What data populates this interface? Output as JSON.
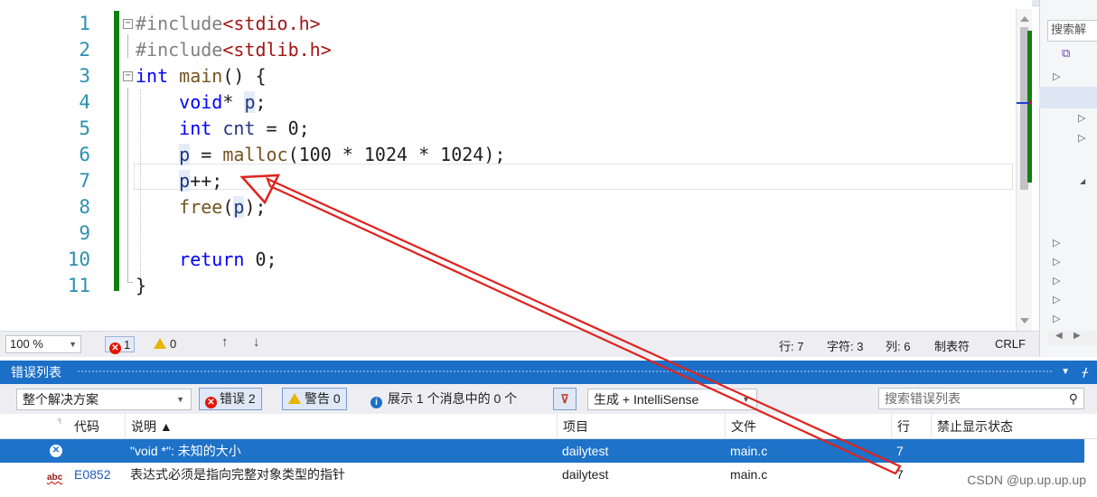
{
  "editor": {
    "line_numbers": [
      "1",
      "2",
      "3",
      "4",
      "5",
      "6",
      "7",
      "8",
      "9",
      "10",
      "11"
    ],
    "lines": [
      [
        {
          "t": "#include",
          "c": "pp"
        },
        {
          "t": "<stdio.h>",
          "c": "str"
        }
      ],
      [
        {
          "t": "#include",
          "c": "pp"
        },
        {
          "t": "<stdlib.h>",
          "c": "str"
        }
      ],
      [
        {
          "t": "int",
          "c": "kw"
        },
        {
          "t": " "
        },
        {
          "t": "main",
          "c": "fn"
        },
        {
          "t": "() {"
        }
      ],
      [
        {
          "t": "    "
        },
        {
          "t": "void",
          "c": "kw"
        },
        {
          "t": "* "
        },
        {
          "t": "p",
          "c": "var hl-var"
        },
        {
          "t": ";"
        }
      ],
      [
        {
          "t": "    "
        },
        {
          "t": "int",
          "c": "kw"
        },
        {
          "t": " "
        },
        {
          "t": "cnt",
          "c": "var"
        },
        {
          "t": " = 0;"
        }
      ],
      [
        {
          "t": "    "
        },
        {
          "t": "p",
          "c": "var hl-var"
        },
        {
          "t": " = "
        },
        {
          "t": "malloc",
          "c": "fn"
        },
        {
          "t": "(100 * 1024 * 1024);"
        }
      ],
      [
        {
          "t": "    "
        },
        {
          "t": "p",
          "c": "var hl-var"
        },
        {
          "t": "++;"
        }
      ],
      [
        {
          "t": "    "
        },
        {
          "t": "free",
          "c": "fn"
        },
        {
          "t": "("
        },
        {
          "t": "p",
          "c": "var hl-var"
        },
        {
          "t": ");"
        }
      ],
      [
        {
          "t": ""
        }
      ],
      [
        {
          "t": "    "
        },
        {
          "t": "return",
          "c": "kw"
        },
        {
          "t": " 0;"
        }
      ],
      [
        {
          "t": "}"
        }
      ]
    ]
  },
  "side_panel": {
    "search_label": "搜索解"
  },
  "status": {
    "zoom": "100 %",
    "errors": "1",
    "warnings": "0",
    "line": "行: 7",
    "char": "字符: 3",
    "col": "列: 6",
    "tabs": "制表符",
    "eol": "CRLF"
  },
  "error_list": {
    "title": "错误列表",
    "scope": "整个解决方案",
    "errors_btn": "错误 2",
    "warnings_btn": "警告 0",
    "messages_btn": "展示 1 个消息中的 0 个",
    "build_filter": "生成 + IntelliSense",
    "search_placeholder": "搜索错误列表",
    "columns": [
      "代码",
      "说明 ▲",
      "项目",
      "文件",
      "行",
      "禁止显示状态"
    ],
    "rows": [
      {
        "code": "",
        "desc": "\"void *\": 未知的大小",
        "project": "dailytest",
        "file": "main.c",
        "line": "7",
        "suppress": ""
      },
      {
        "code": "E0852",
        "desc": "表达式必须是指向完整对象类型的指针",
        "project": "dailytest",
        "file": "main.c",
        "line": "7",
        "suppress": ""
      }
    ]
  },
  "watermark": "CSDN @up.up.up.up",
  "colors": {
    "accent": "#1c6fc6",
    "selected_row": "#1e72c8",
    "error": "#e51400",
    "warning": "#e8b400",
    "change_bar": "#108010",
    "annotation_arrow": "#e0221e"
  }
}
